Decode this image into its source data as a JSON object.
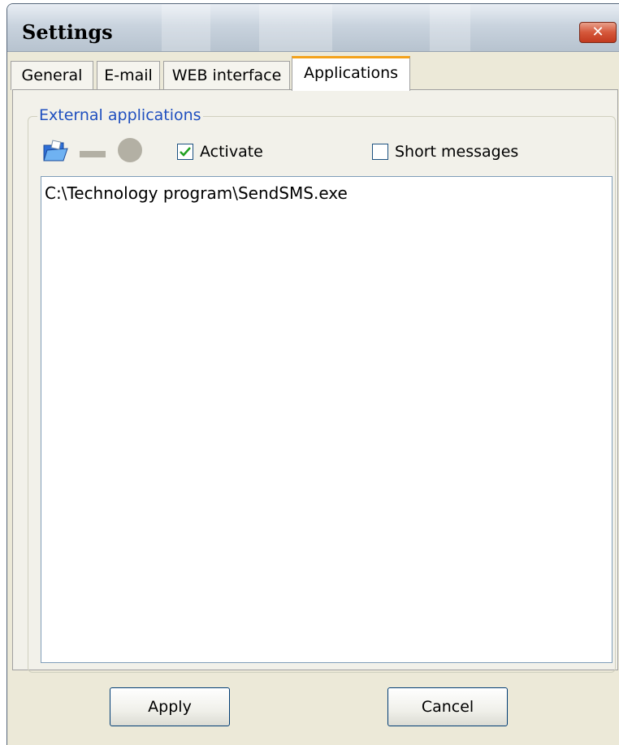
{
  "window": {
    "title": "Settings",
    "close_glyph": "✕"
  },
  "tabs": [
    {
      "label": "General",
      "active": false
    },
    {
      "label": "E-mail",
      "active": false
    },
    {
      "label": "WEB interface",
      "active": false
    },
    {
      "label": "Applications",
      "active": true
    }
  ],
  "group": {
    "label": "External applications",
    "toolbar": {
      "icons": [
        "open-folder-icon",
        "remove-icon",
        "record-icon"
      ],
      "activate": {
        "label": "Activate",
        "checked": true
      },
      "short_messages": {
        "label": "Short messages",
        "checked": false
      }
    },
    "list": {
      "items": [
        "C:\\Technology program\\SendSMS.exe"
      ]
    }
  },
  "buttons": {
    "apply": "Apply",
    "cancel": "Cancel"
  },
  "colors": {
    "tab_accent": "#f4a21a",
    "group_label": "#1f4fbf",
    "close_button": "#d5573a"
  }
}
